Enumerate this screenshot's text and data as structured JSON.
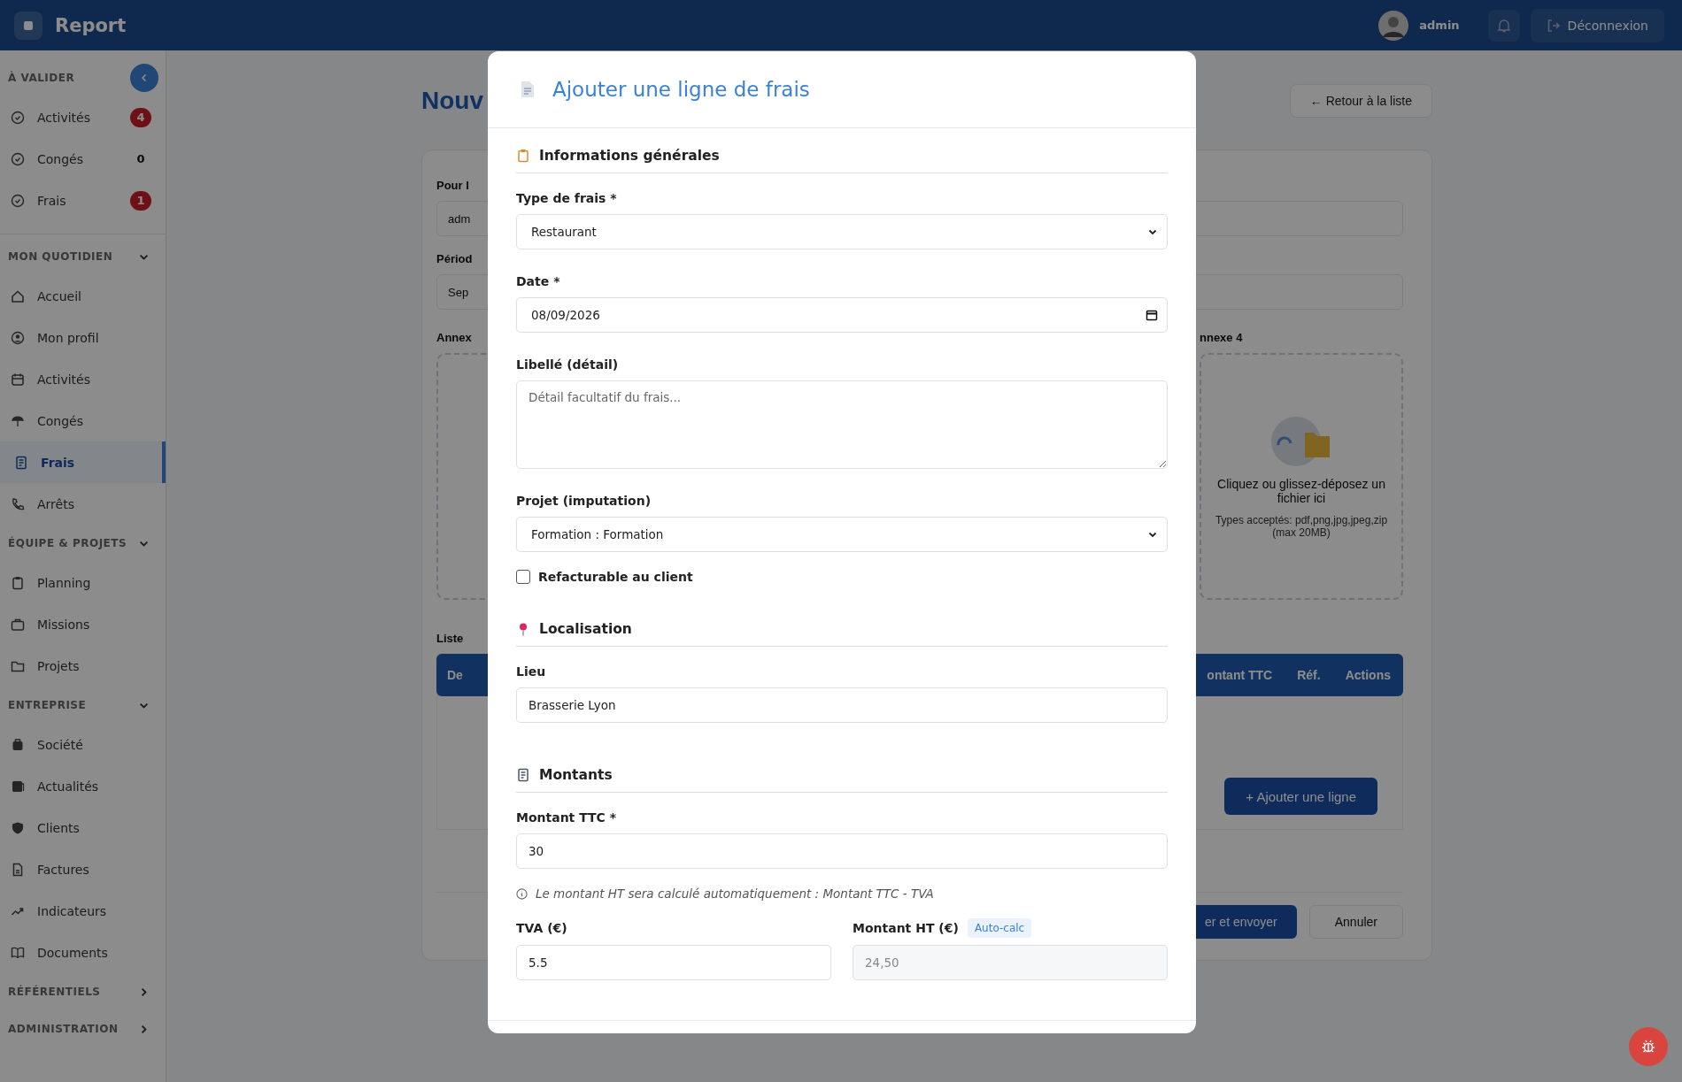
{
  "topbar": {
    "app_name": "Report",
    "user_name": "admin",
    "logout_label": "Déconnexion"
  },
  "sidebar": {
    "sections": [
      {
        "title": "À VALIDER",
        "kind": "validation",
        "items": [
          {
            "label": "Activités",
            "count": "4",
            "alert": true
          },
          {
            "label": "Congés",
            "count": "0",
            "alert": false
          },
          {
            "label": "Frais",
            "count": "1",
            "alert": true
          }
        ]
      },
      {
        "title": "MON QUOTIDIEN",
        "kind": "group",
        "expanded": true,
        "items": [
          {
            "label": "Accueil",
            "selected": false
          },
          {
            "label": "Mon profil",
            "selected": false
          },
          {
            "label": "Activités",
            "selected": false
          },
          {
            "label": "Congés",
            "selected": false
          },
          {
            "label": "Frais",
            "selected": true
          },
          {
            "label": "Arrêts",
            "selected": false
          }
        ]
      },
      {
        "title": "ÉQUIPE & PROJETS",
        "kind": "group",
        "expanded": true,
        "items": [
          {
            "label": "Planning",
            "selected": false
          },
          {
            "label": "Missions",
            "selected": false
          },
          {
            "label": "Projets",
            "selected": false
          }
        ]
      },
      {
        "title": "ENTREPRISE",
        "kind": "group",
        "expanded": true,
        "items": [
          {
            "label": "Société",
            "selected": false
          },
          {
            "label": "Actualités",
            "selected": false
          },
          {
            "label": "Clients",
            "selected": false
          },
          {
            "label": "Factures",
            "selected": false
          },
          {
            "label": "Indicateurs",
            "selected": false
          },
          {
            "label": "Documents",
            "selected": false
          }
        ]
      },
      {
        "title": "RÉFÉRENTIELS",
        "kind": "group",
        "expanded": false
      },
      {
        "title": "ADMINISTRATION",
        "kind": "group",
        "expanded": false
      }
    ]
  },
  "page": {
    "title": "Nouv",
    "back_button": "← Retour à la liste",
    "fields": [
      {
        "label": "Pour l",
        "value": "adm"
      },
      {
        "label": "Périod",
        "value": "Sep"
      }
    ],
    "annex_left_label": "Annex",
    "annex_right_label": "nnexe 4",
    "dropzone": {
      "text": "Cliquez ou glissez-déposez un fichier ici",
      "hint": "Types acceptés: pdf,png,jpg,jpeg,zip (max 20MB)"
    },
    "list_label": "Liste",
    "table_columns_left": [
      "De"
    ],
    "table_columns_right": [
      "ontant TTC",
      "Réf.",
      "Actions"
    ],
    "add_button": "+ Ajouter une ligne",
    "submit_button": "er et envoyer",
    "cancel_button": "Annuler"
  },
  "modal": {
    "title": "Ajouter une ligne de frais",
    "sections": [
      {
        "title": "Informations générales",
        "fields": [
          {
            "kind": "select",
            "label": "Type de frais *",
            "value": "Restaurant"
          },
          {
            "kind": "date",
            "label": "Date *",
            "value": "08/09/2026"
          },
          {
            "kind": "textarea",
            "label": "Libellé (détail)",
            "placeholder": "Détail facultatif du frais..."
          },
          {
            "kind": "select",
            "label": "Projet (imputation)",
            "value": "Formation : Formation"
          },
          {
            "kind": "checkbox",
            "label": "Refacturable au client",
            "checked": false
          }
        ]
      },
      {
        "title": "Localisation",
        "fields": [
          {
            "kind": "text",
            "label": "Lieu",
            "value": "Brasserie Lyon"
          }
        ]
      },
      {
        "title": "Montants",
        "fields": [
          {
            "kind": "text",
            "label": "Montant TTC *",
            "value": "30"
          },
          {
            "kind": "note",
            "text": "Le montant HT sera calculé automatiquement : Montant TTC - TVA"
          },
          {
            "kind": "pair",
            "fields": [
              {
                "kind": "text",
                "label": "TVA (€)",
                "value": "5.5"
              },
              {
                "kind": "readonly",
                "label": "Montant HT (€)",
                "badge": "Auto-calc",
                "value": "24,50"
              }
            ]
          }
        ]
      }
    ]
  }
}
